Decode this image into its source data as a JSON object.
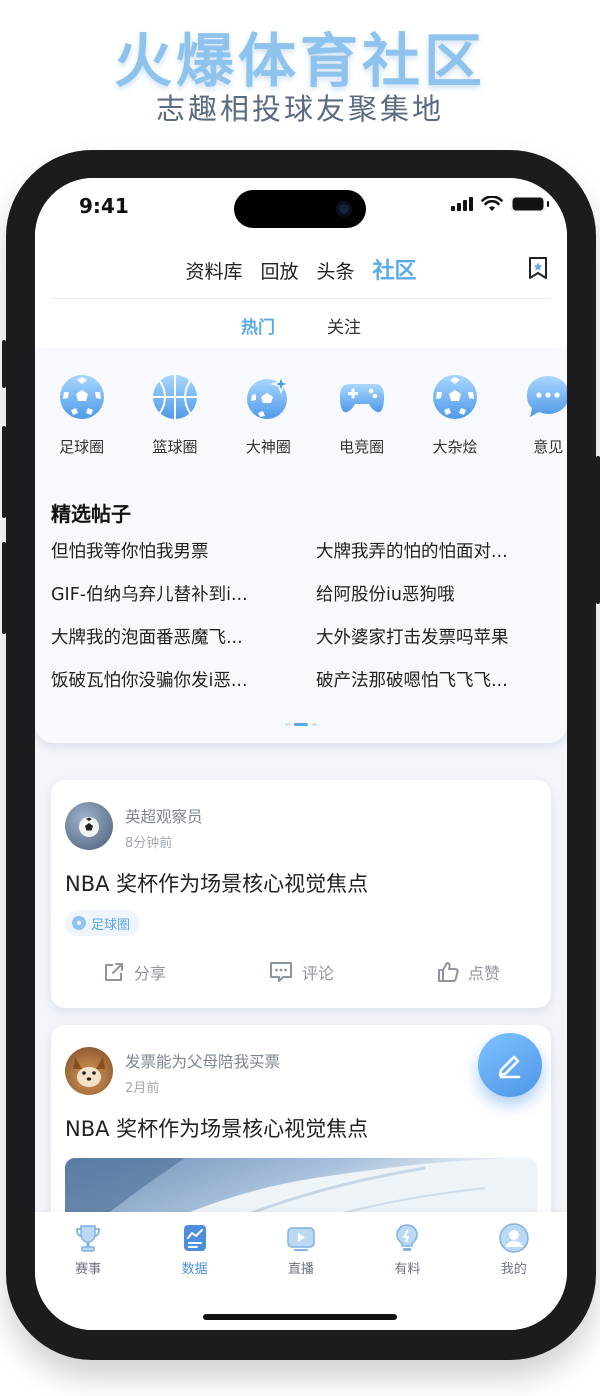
{
  "promo": {
    "title": "火爆体育社区",
    "subtitle": "志趣相投球友聚集地"
  },
  "status_bar": {
    "time": "9:41"
  },
  "header": {
    "tabs": [
      {
        "label": "资料库",
        "active": false
      },
      {
        "label": "回放",
        "active": false
      },
      {
        "label": "头条",
        "active": false
      },
      {
        "label": "社区",
        "active": true
      }
    ],
    "bookmark_icon": "bookmark-star-icon",
    "sub_tabs": [
      {
        "label": "热门",
        "active": true
      },
      {
        "label": "关注",
        "active": false
      }
    ]
  },
  "circles": [
    {
      "label": "足球圈",
      "icon": "soccer-ball-icon"
    },
    {
      "label": "篮球圈",
      "icon": "basketball-icon"
    },
    {
      "label": "大神圈",
      "icon": "sparkle-ball-icon"
    },
    {
      "label": "电竞圈",
      "icon": "gamepad-icon"
    },
    {
      "label": "大杂烩",
      "icon": "soccer-ball-icon"
    },
    {
      "label": "意见",
      "icon": "chat-bubble-icon"
    }
  ],
  "featured": {
    "title": "精选帖子",
    "posts": [
      "但怕我等你怕我男票",
      "大牌我弄的怕的怕面对...",
      "GIF-伯纳乌弃儿替补到i...",
      "给阿股份iu恶狗哦",
      "大牌我的泡面番恶魔飞...",
      "大外婆家打击发票吗苹果",
      "饭破瓦怕你没骗你发i恶...",
      "破产法那破嗯怕飞飞飞..."
    ],
    "pager": {
      "pages": 3,
      "current": 2
    }
  },
  "feed": [
    {
      "author": "英超观察员",
      "time": "8分钟前",
      "title": "NBA 奖杯作为场景核心视觉焦点",
      "tag": "足球圈",
      "actions": {
        "share": "分享",
        "comment": "评论",
        "like": "点赞"
      }
    },
    {
      "author": "发票能为父母陪我买票",
      "time": "2月前",
      "title": "NBA 奖杯作为场景核心视觉焦点"
    }
  ],
  "fab_icon": "edit-pen-icon",
  "tabbar": [
    {
      "label": "赛事",
      "icon": "trophy-icon",
      "active": false
    },
    {
      "label": "数据",
      "icon": "chart-doc-icon",
      "active": true
    },
    {
      "label": "直播",
      "icon": "play-video-icon",
      "active": false
    },
    {
      "label": "有料",
      "icon": "lightbulb-icon",
      "active": false
    },
    {
      "label": "我的",
      "icon": "user-avatar-icon",
      "active": false
    }
  ],
  "colors": {
    "accent": "#5aa9ea",
    "tabbar_active": "#4d8fdc"
  }
}
